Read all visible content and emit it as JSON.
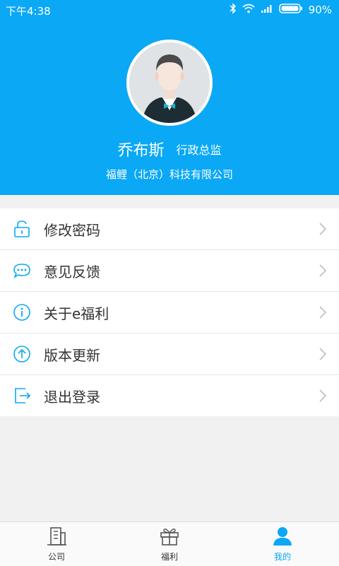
{
  "status": {
    "time": "下午4:38",
    "battery": "90%"
  },
  "profile": {
    "name": "乔布斯",
    "title": "行政总监",
    "company": "福鲤（北京）科技有限公司"
  },
  "menu": [
    {
      "label": "修改密码",
      "icon": "lock-icon"
    },
    {
      "label": "意见反馈",
      "icon": "chat-bubble-icon"
    },
    {
      "label": "关于e福利",
      "icon": "info-icon"
    },
    {
      "label": "版本更新",
      "icon": "upload-arrow-icon"
    },
    {
      "label": "退出登录",
      "icon": "logout-icon"
    }
  ],
  "tabs": [
    {
      "label": "公司",
      "icon": "building-icon"
    },
    {
      "label": "福利",
      "icon": "gift-icon"
    },
    {
      "label": "我的",
      "icon": "person-icon",
      "active": true
    }
  ],
  "colors": {
    "primary": "#0aa8f5",
    "background": "#f1f1f1"
  }
}
